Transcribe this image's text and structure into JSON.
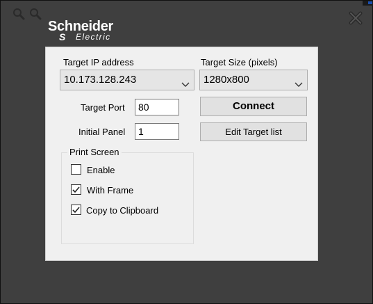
{
  "brand": {
    "name": "Schneider",
    "sub": "Electric",
    "mark": "S"
  },
  "colors": {
    "window_bg": "#3f3f3f",
    "panel_bg": "#f0f0f0",
    "accent": "#1b4fb0"
  },
  "icons": {
    "zoom_in": "zoom-in-icon",
    "zoom_out": "zoom-out-icon",
    "close": "close-icon",
    "dropdown": "chevron-down-icon",
    "check": "checkmark-icon"
  },
  "target_ip": {
    "label": "Target IP address",
    "value": "10.173.128.243"
  },
  "target_size": {
    "label": "Target Size (pixels)",
    "value": "1280x800"
  },
  "target_port": {
    "label": "Target Port",
    "value": "80"
  },
  "initial_panel": {
    "label": "Initial Panel",
    "value": "1"
  },
  "buttons": {
    "connect": "Connect",
    "edit_target_list": "Edit Target list"
  },
  "print_screen": {
    "title": "Print Screen",
    "options": [
      {
        "label": "Enable",
        "checked": false
      },
      {
        "label": "With Frame",
        "checked": true
      },
      {
        "label": "Copy to Clipboard",
        "checked": true
      }
    ]
  }
}
